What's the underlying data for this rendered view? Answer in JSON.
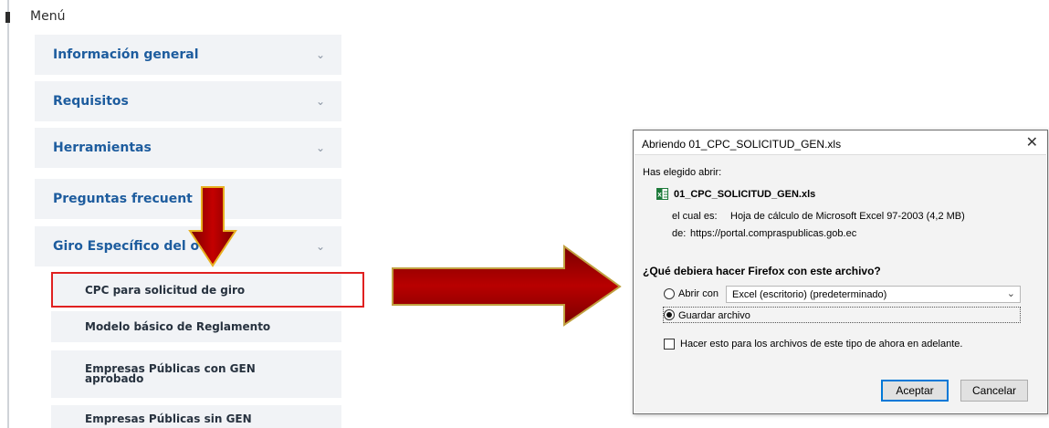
{
  "menu": {
    "title": "Menú",
    "items": [
      {
        "label": "Información general"
      },
      {
        "label": "Requisitos"
      },
      {
        "label": "Herramientas"
      },
      {
        "label": "Preguntas frecuent"
      },
      {
        "label": "Giro Específico del   ocio"
      }
    ],
    "subitems": [
      {
        "label": "CPC para solicitud de giro"
      },
      {
        "label": "Modelo básico de Reglamento"
      },
      {
        "label_line1": "Empresas Públicas con GEN",
        "label_line2": "aprobado"
      },
      {
        "label": "Empresas Públicas sin GEN"
      }
    ]
  },
  "dialog": {
    "title": "Abriendo 01_CPC_SOLICITUD_GEN.xls",
    "intro": "Has elegido abrir:",
    "filename": "01_CPC_SOLICITUD_GEN.xls",
    "type_label": "el cual es:",
    "type_value": "Hoja de cálculo de Microsoft Excel 97-2003 (4,2 MB)",
    "from_label": "de:",
    "from_value": "https://portal.compraspublicas.gob.ec",
    "question": "¿Qué debiera hacer Firefox con este archivo?",
    "open_with_label": "Abrir con",
    "open_with_value": "Excel (escritorio) (predeterminado)",
    "save_label": "Guardar archivo",
    "remember_label": "Hacer esto para los archivos de este tipo de ahora en adelante.",
    "ok_label": "Aceptar",
    "cancel_label": "Cancelar"
  },
  "colors": {
    "menu_link": "#1d5c9e",
    "arrow": "#a50000",
    "highlight": "#e02020",
    "button_focus": "#0078d7"
  },
  "icons": [
    "chevron-down-icon",
    "close-icon",
    "excel-file-icon",
    "arrow-down-icon",
    "arrow-right-icon"
  ]
}
